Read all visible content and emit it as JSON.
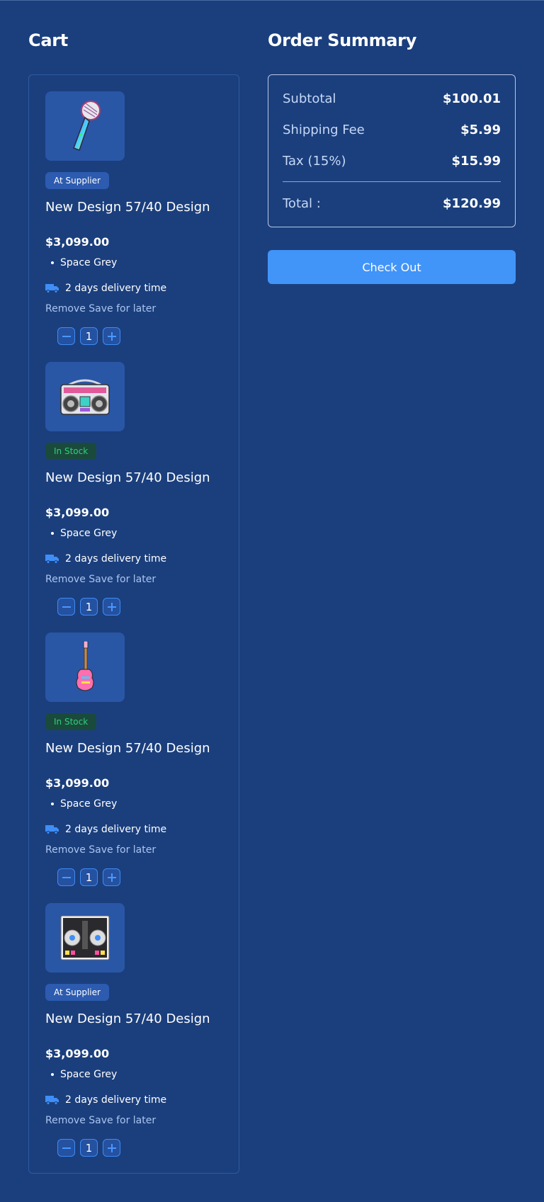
{
  "cart": {
    "title": "Cart",
    "items": [
      {
        "image": "microphone-icon",
        "badge": "At Supplier",
        "name": "New Design 57/40 Design",
        "price": "$3,099.00",
        "color": "Space Grey",
        "delivery": "2 days delivery time",
        "remove_label": "Remove",
        "save_label": "Save for later",
        "quantity": "1"
      },
      {
        "image": "boombox-icon",
        "badge": "In Stock",
        "name": "New Design 57/40 Design",
        "price": "$3,099.00",
        "color": "Space Grey",
        "delivery": "2 days delivery time",
        "remove_label": "Remove",
        "save_label": "Save for later",
        "quantity": "1"
      },
      {
        "image": "guitar-icon",
        "badge": "In Stock",
        "name": "New Design 57/40 Design",
        "price": "$3,099.00",
        "color": "Space Grey",
        "delivery": "2 days delivery time",
        "remove_label": "Remove",
        "save_label": "Save for later",
        "quantity": "1"
      },
      {
        "image": "dj-controller-icon",
        "badge": "At Supplier",
        "name": "New Design 57/40 Design",
        "price": "$3,099.00",
        "color": "Space Grey",
        "delivery": "2 days delivery time",
        "remove_label": "Remove",
        "save_label": "Save for later",
        "quantity": "1"
      }
    ]
  },
  "summary": {
    "title": "Order Summary",
    "subtotal_label": "Subtotal",
    "subtotal_value": "$100.01",
    "shipping_label": "Shipping Fee",
    "shipping_value": "$5.99",
    "tax_label": "Tax (15%)",
    "tax_value": "$15.99",
    "total_label": "Total :",
    "total_value": "$120.99",
    "checkout_label": "Check Out"
  },
  "colors": {
    "background": "#1b3f7d",
    "accent": "#4194f8",
    "in_stock_text": "#2fd17a",
    "link": "#a9c4f0"
  }
}
